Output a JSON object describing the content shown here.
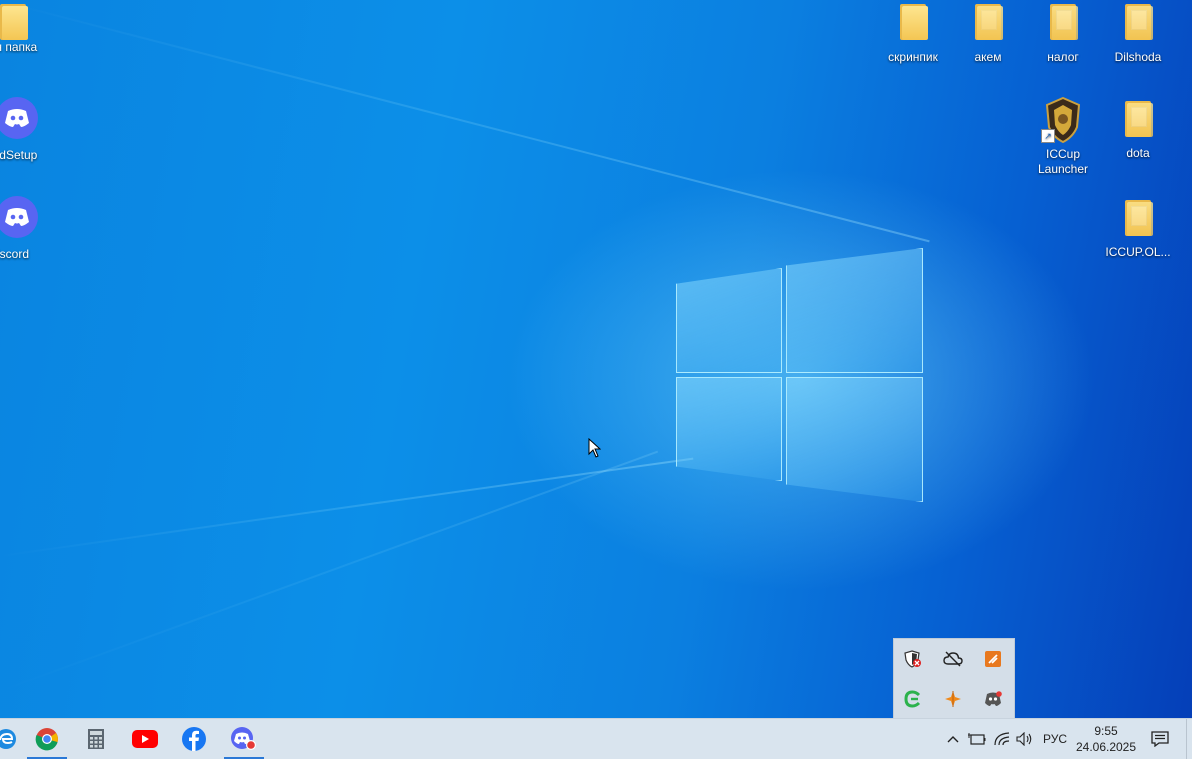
{
  "desktop_icons_left": [
    {
      "label": "ая папка"
    },
    {
      "label": "ordSetup"
    },
    {
      "label": "iscord"
    }
  ],
  "desktop_icons_right": [
    {
      "label": "скринпик"
    },
    {
      "label": "акем"
    },
    {
      "label": "налог"
    },
    {
      "label": "Dilshoda"
    },
    {
      "label": "ICCup Launcher"
    },
    {
      "label": "dota"
    },
    {
      "label": "ICCUP.OL..."
    }
  ],
  "taskbar": {
    "apps": [
      "edge-icon",
      "chrome-icon",
      "calculator-icon",
      "youtube-icon",
      "facebook-icon",
      "discord-icon"
    ],
    "language": "РУС",
    "time": "9:55",
    "date": "24.06.2025"
  },
  "tray_overflow": {
    "icons": [
      "security-shield-icon",
      "cloud-offline-icon",
      "app-orange-icon",
      "green-app-icon",
      "orange-star-icon",
      "discord-tray-icon"
    ]
  },
  "colors": {
    "accent": "#2a78d6",
    "discord": "#5865f2",
    "taskbar": "#d9e4ee"
  }
}
